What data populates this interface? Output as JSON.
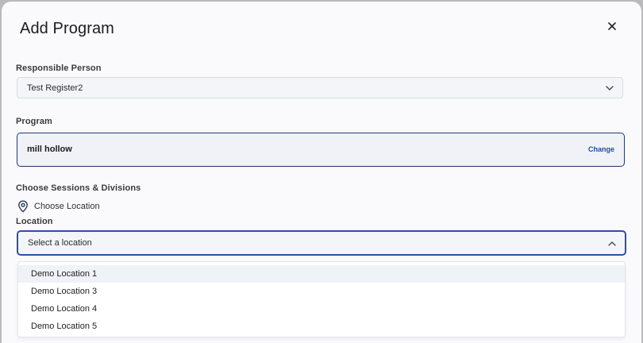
{
  "modal": {
    "title": "Add Program",
    "close_icon": "close-icon"
  },
  "responsible_person": {
    "label": "Responsible Person",
    "value": "Test Register2"
  },
  "program": {
    "label": "Program",
    "name": "mill hollow",
    "change_label": "Change"
  },
  "sessions": {
    "label": "Choose Sessions & Divisions",
    "choose_location_label": "Choose Location",
    "choose_location_icon": "map-pin-icon"
  },
  "location": {
    "label": "Location",
    "placeholder": "Select a location",
    "options": [
      "Demo Location 1",
      "Demo Location 3",
      "Demo Location 4",
      "Demo Location 5"
    ],
    "highlighted_option": "Demo Location 1"
  }
}
